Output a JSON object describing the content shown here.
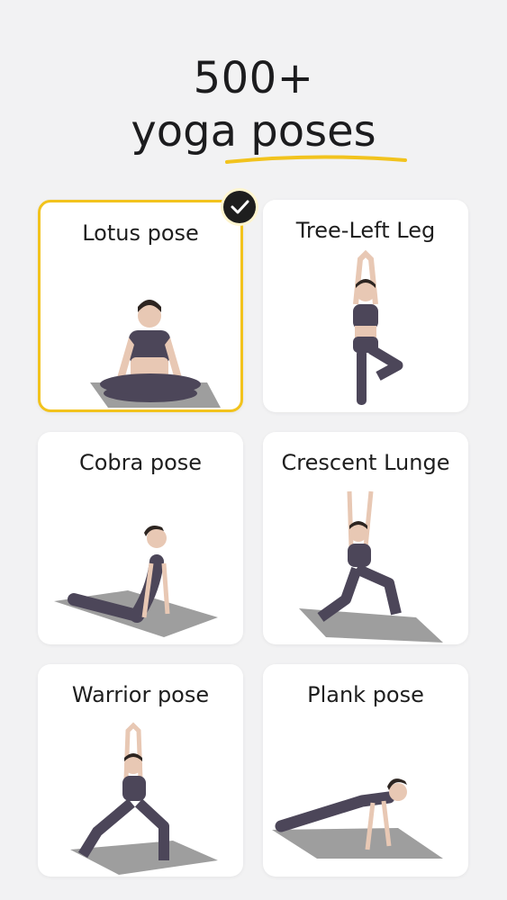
{
  "headline": {
    "line1": "500+",
    "line2": "yoga poses"
  },
  "accent_color": "#f2c31d",
  "selected_pose": "Lotus pose",
  "poses": [
    {
      "label": "Lotus pose",
      "selected": true
    },
    {
      "label": "Tree-Left Leg",
      "selected": false
    },
    {
      "label": "Cobra pose",
      "selected": false
    },
    {
      "label": "Crescent Lunge",
      "selected": false
    },
    {
      "label": "Warrior pose",
      "selected": false
    },
    {
      "label": "Plank pose",
      "selected": false
    }
  ],
  "icons": {
    "selected_badge": "checkmark-icon"
  }
}
